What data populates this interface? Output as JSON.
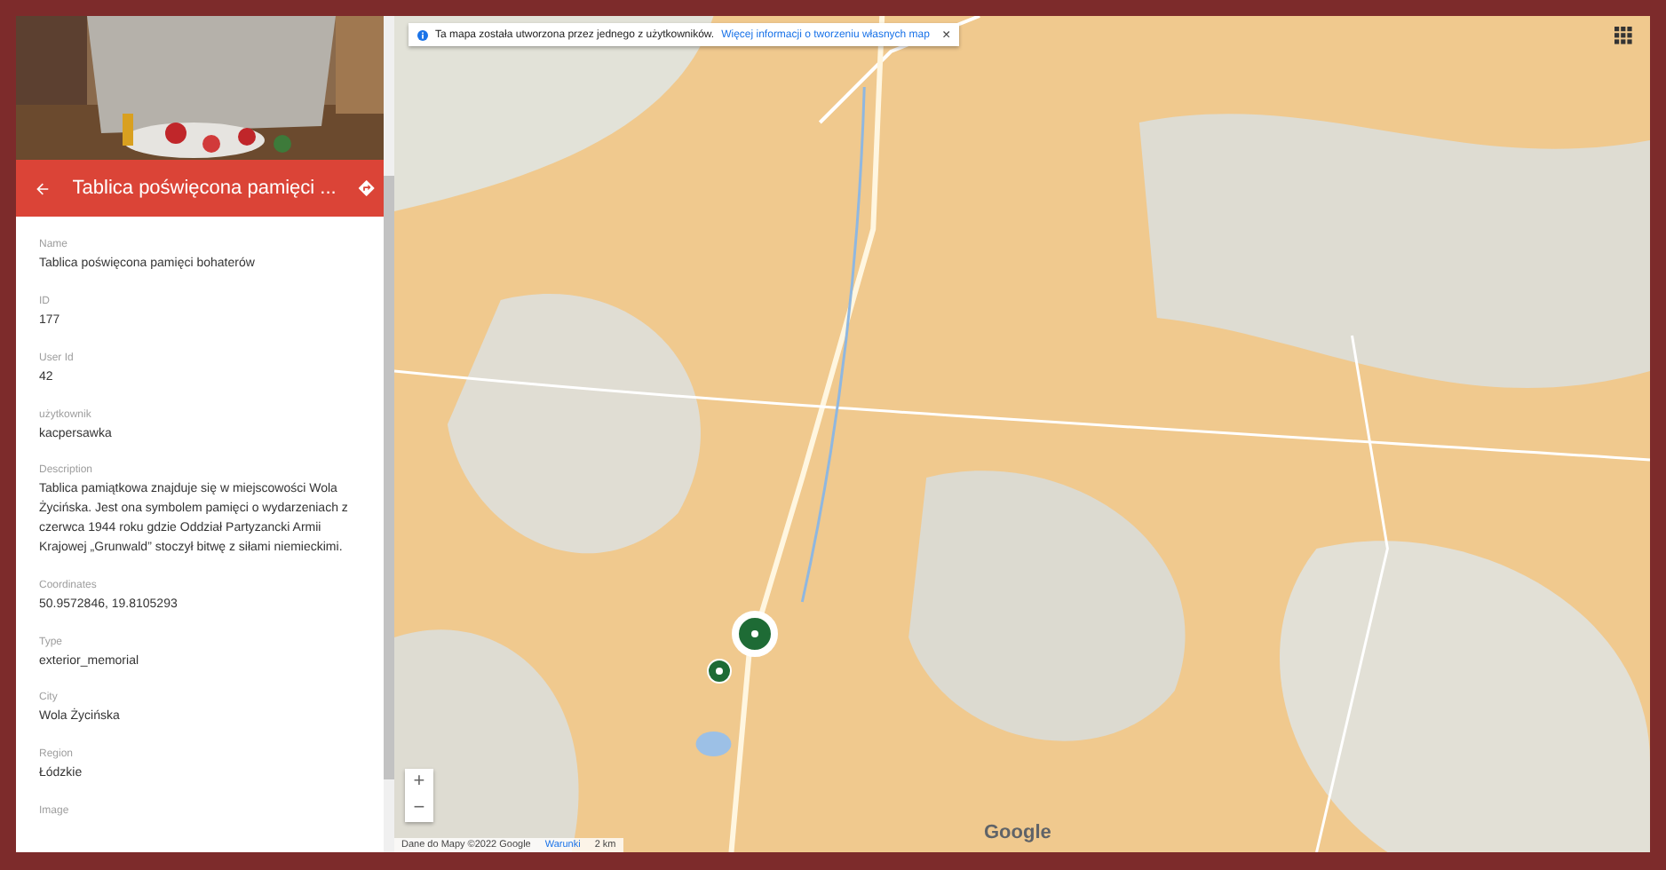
{
  "place": {
    "title": "Tablica poświęcona pamięci ..."
  },
  "fields": [
    {
      "label": "Name",
      "value": "Tablica poświęcona pamięci bohaterów"
    },
    {
      "label": "ID",
      "value": "177"
    },
    {
      "label": "User Id",
      "value": "42"
    },
    {
      "label": "użytkownik",
      "value": "kacpersawka"
    },
    {
      "label": "Description",
      "value": "Tablica pamiątkowa znajduje się w miejscowości Wola Życińska. Jest ona symbolem pamięci o wydarzeniach z czerwca 1944 roku gdzie Oddział Partyzancki Armii Krajowej „Grunwald” stoczył bitwę z siłami niemieckimi."
    },
    {
      "label": "Coordinates",
      "value": "50.9572846, 19.8105293"
    },
    {
      "label": "Type",
      "value": "exterior_memorial"
    },
    {
      "label": "City",
      "value": "Wola Życińska"
    },
    {
      "label": "Region",
      "value": "Łódzkie"
    },
    {
      "label": "Image"
    }
  ],
  "banner": {
    "text": "Ta mapa została utworzona przez jednego z użytkowników.",
    "link": "Więcej informacji o tworzeniu własnych map",
    "close": "×"
  },
  "markers": [
    {
      "selected": true
    },
    {
      "selected": false
    }
  ],
  "zoom": {
    "in": "+",
    "out": "−"
  },
  "logo": "Google",
  "attribution": {
    "text": "Dane do Mapy ©2022 Google",
    "terms": "Warunki",
    "scale": "2 km"
  }
}
